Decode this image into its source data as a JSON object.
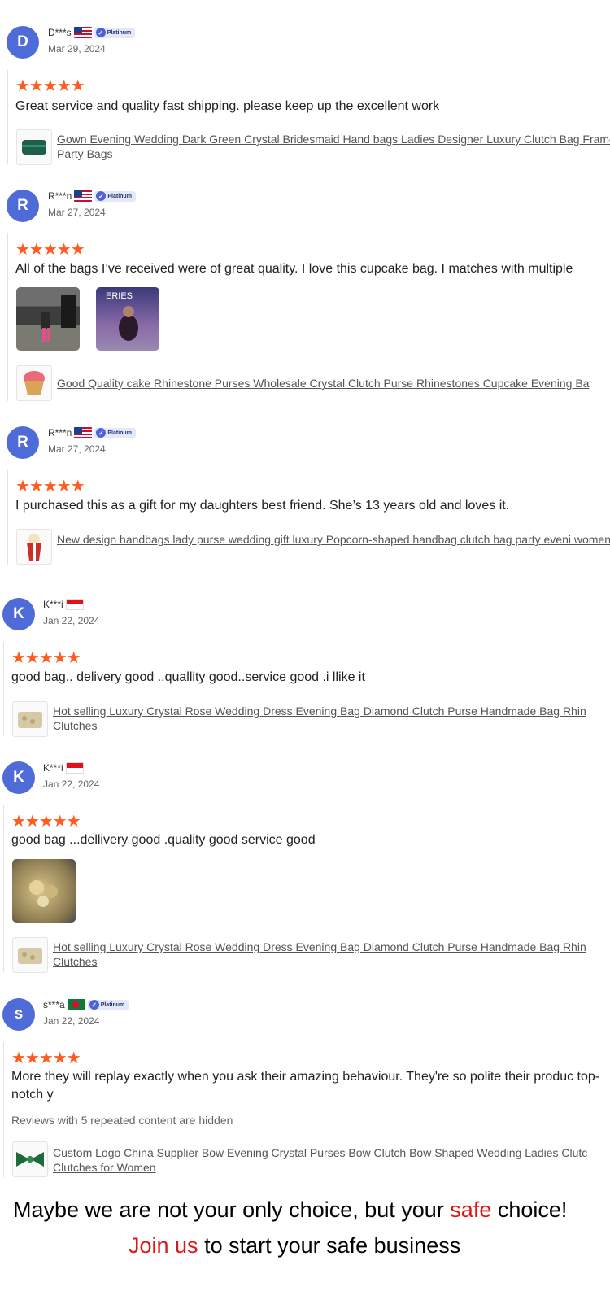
{
  "reviews": [
    {
      "initial": "D",
      "name": "D***s",
      "badge": "Platinum",
      "date": "Mar 29, 2024",
      "stars": "★★★★★",
      "text": "Great service and quality fast shipping. please keep up the excellent work",
      "product": "Gown Evening Wedding Dark Green Crystal Bridesmaid Hand bags Ladies Designer Luxury Clutch Bag Frame Party Bags"
    },
    {
      "initial": "R",
      "name": "R***n",
      "badge": "Platinum",
      "date": "Mar 27, 2024",
      "stars": "★★★★★",
      "text": "All of the bags I’ve received were of great quality. I love this cupcake bag. I matches with multiple",
      "product": "Good Quality cake Rhinestone Purses Wholesale Crystal Clutch Purse Rhinestones Cupcake Evening Ba"
    },
    {
      "initial": "R",
      "name": "R***n",
      "badge": "Platinum",
      "date": "Mar 27, 2024",
      "stars": "★★★★★",
      "text": "I purchased this as a gift for my daughters best friend. She’s 13 years old and loves it.",
      "product": "New design handbags lady purse wedding gift luxury Popcorn-shaped handbag clutch bag party eveni women"
    },
    {
      "initial": "K",
      "name": "K***i",
      "date": "Jan 22, 2024",
      "stars": "★★★★★",
      "text": "good bag.. delivery good ..quallity good..service good .i llike it",
      "product": "Hot selling Luxury Crystal Rose Wedding Dress Evening Bag Diamond Clutch Purse Handmade Bag Rhin Clutches"
    },
    {
      "initial": "K",
      "name": "K***i",
      "date": "Jan 22, 2024",
      "stars": "★★★★★",
      "text": "good bag ...dellivery good .quality good service good",
      "product": "Hot selling Luxury Crystal Rose Wedding Dress Evening Bag Diamond Clutch Purse Handmade Bag Rhin Clutches"
    },
    {
      "initial": "s",
      "name": "s***a",
      "badge": "Platinum",
      "date": "Jan 22, 2024",
      "stars": "★★★★★",
      "text": "More they will replay exactly when you ask their amazing behaviour. They're so polite their produc top-notch y",
      "note": "Reviews with 5 repeated content are hidden",
      "product": "Custom Logo China Supplier Bow Evening Crystal Purses Bow Clutch Bow Shaped Wedding Ladies Clutc Clutches for Women"
    }
  ],
  "banner": {
    "line1_a": "Maybe we are not your only choice, but your ",
    "line1_b": "safe",
    "line1_c": " choice!",
    "line2_a": "Join us",
    "line2_b": " to start your safe business"
  },
  "colors": {
    "star": "#ff5a1f",
    "avatar": "#4f6bd8",
    "banner_accent": "#e01414"
  }
}
